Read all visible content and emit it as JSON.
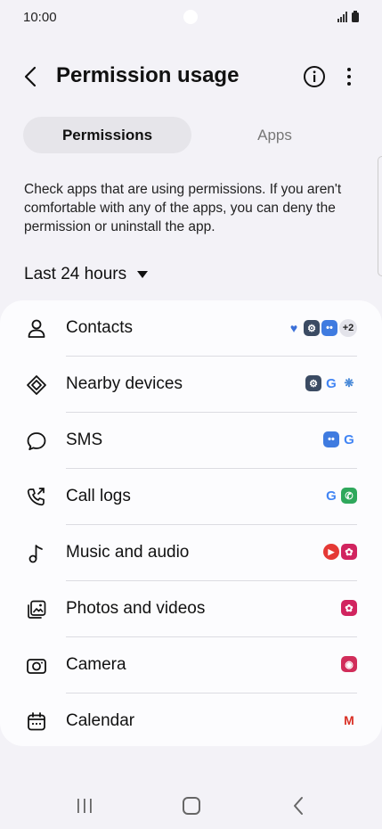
{
  "status": {
    "time": "10:00"
  },
  "appbar": {
    "title": "Permission usage"
  },
  "tabs": [
    {
      "label": "Permissions"
    },
    {
      "label": "Apps"
    }
  ],
  "description": "Check apps that are using permissions. If you aren't comfortable with any of the apps, you can deny the permission or uninstall the app.",
  "range": {
    "label": "Last 24 hours"
  },
  "permissions": [
    {
      "label": "Contacts",
      "icon": "person-icon",
      "apps_extra": "+2"
    },
    {
      "label": "Nearby devices",
      "icon": "nearby-devices-icon"
    },
    {
      "label": "SMS",
      "icon": "message-bubble-icon"
    },
    {
      "label": "Call logs",
      "icon": "call-log-icon"
    },
    {
      "label": "Music and audio",
      "icon": "music-note-icon"
    },
    {
      "label": "Photos and videos",
      "icon": "photos-icon"
    },
    {
      "label": "Camera",
      "icon": "camera-icon"
    },
    {
      "label": "Calendar",
      "icon": "calendar-icon"
    }
  ],
  "colors": {
    "background": "#f3f2f7",
    "card": "#fcfcfe",
    "tab_active": "#e6e5ea"
  }
}
